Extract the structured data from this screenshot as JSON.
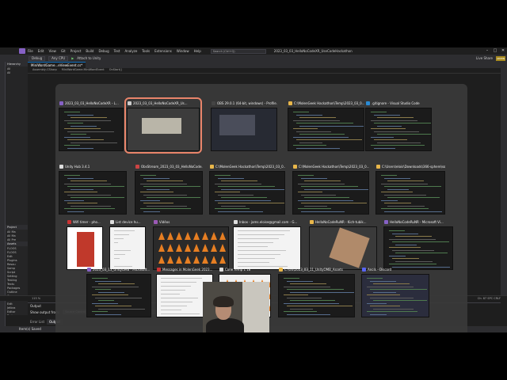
{
  "app": {
    "title": "2023_03_03_HelloNoCodeXR_UseCodeHackathon",
    "search_placeholder": "Search (Ctrl+Q)",
    "admin_label": "ADMIN",
    "live_share": "Live Share",
    "menu": [
      "File",
      "Edit",
      "View",
      "Git",
      "Project",
      "Build",
      "Debug",
      "Test",
      "Analyze",
      "Tools",
      "Extensions",
      "Window",
      "Help"
    ]
  },
  "toolbar": {
    "config": "Debug",
    "platform": "Any CPU",
    "run_label": "Attach to Unity"
  },
  "doc_tabs": [
    {
      "label": "MiniWordGame...eViewEvent.cs*",
      "active": true
    }
  ],
  "nav_bar": {
    "project": "Assembly-CSharp",
    "class": "MiniWordGame.MiniWordEvent",
    "member": "OnStart()"
  },
  "left_panel": {
    "header_top": "Hierarchy",
    "items_top": [
      "All",
      "All"
    ],
    "header_project": "Project",
    "items_project": [
      "All Ma",
      "All Ma",
      "All Pre"
    ],
    "header_assets": "Assets",
    "items_assets": [
      "FLOOS",
      "FLOOS",
      "Edit",
      "Plugins",
      "Resou",
      "Samp",
      "Script",
      "Setting",
      "Testing",
      "Textu",
      "Packages",
      "Outline",
      "Core",
      "Cust",
      "Edit",
      "Jetbra",
      "Editor",
      "Test",
      "Timel",
      "Unity"
    ]
  },
  "switcher": {
    "windows": [
      {
        "title": "2023_03_03_HelloNoCodeXR - L...",
        "icon": "vs-icon",
        "icon_color": "#8661c5",
        "thumb": "dark",
        "selected": false
      },
      {
        "title": "2023_03_03_HelloNoCodeXR_Us...",
        "icon": "unity-icon",
        "icon_color": "#cccccc",
        "thumb": "unity",
        "selected": true
      },
      {
        "title": "OBS 29.0.1 (64-bit, windows) - Profile...",
        "icon": "obs-icon",
        "icon_color": "#444444",
        "thumb": "obs",
        "selected": false
      },
      {
        "title": "C:\\MolenGeek Hackathon\\Temp\\2023_03_0...",
        "icon": "folder-icon",
        "icon_color": "#e8b64a",
        "thumb": "dark",
        "selected": false
      },
      {
        "title": ".gitignore - Visual Studio Code",
        "icon": "vscode-icon",
        "icon_color": "#2a8ad4",
        "thumb": "dark",
        "selected": false
      },
      {
        "title": "Unity Hub 3.4.1",
        "icon": "unity-hub-icon",
        "icon_color": "#dddddd",
        "thumb": "dark",
        "selected": false
      },
      {
        "title": "ObsStream_2023_03_03_HelloNoCode...",
        "icon": "unity-icon",
        "icon_color": "#cc4444",
        "thumb": "dark",
        "selected": false
      },
      {
        "title": "C:\\MolenGeek Hackathon\\Temp\\2023_03_0...",
        "icon": "folder-icon",
        "icon_color": "#e8b64a",
        "thumb": "dark",
        "selected": false
      },
      {
        "title": "C:\\MolenGeek Hackathon\\Temp\\2023_03_0...",
        "icon": "folder-icon",
        "icon_color": "#e8b64a",
        "thumb": "dark",
        "selected": false
      },
      {
        "title": "C:\\Users\\elois\\Downloads\\366-sphere\\source",
        "icon": "folder-icon",
        "icon_color": "#e8b64a",
        "thumb": "dark",
        "selected": false
      },
      {
        "title": "Wifi timer - pho...",
        "icon": "browser-icon",
        "icon_color": "#cc3333",
        "thumb": "phone",
        "selected": false
      },
      {
        "title": "List device hu...",
        "icon": "browser-icon",
        "icon_color": "#dddddd",
        "thumb": "light",
        "selected": false
      },
      {
        "title": "Vidéos",
        "icon": "video-icon",
        "icon_color": "#9b59b6",
        "thumb": "cones",
        "selected": false
      },
      {
        "title": "Inbox - jams.eloise@gmail.com - G...",
        "icon": "mail-icon",
        "icon_color": "#dddddd",
        "thumb": "light",
        "selected": false
      },
      {
        "title": "HelloNoCodeRuNR - Kich-tubik...",
        "icon": "app-icon",
        "icon_color": "#e8b64a",
        "thumb": "photo",
        "selected": false
      },
      {
        "title": "HelloNoCodeRuNR - Microsoft Vi...",
        "icon": "vs-icon",
        "icon_color": "#8661c5",
        "thumb": "dark",
        "selected": false
      },
      {
        "title": "2023_03_13_UnityOMB - Microsoft...",
        "icon": "vs-icon",
        "icon_color": "#8661c5",
        "thumb": "dark",
        "selected": false
      },
      {
        "title": "Messages in MolenGeek 2023...",
        "icon": "message-icon",
        "icon_color": "#cc3333",
        "thumb": "light",
        "selected": false
      },
      {
        "title": "Cone Temp 1 18",
        "icon": "image-icon",
        "icon_color": "#dddddd",
        "thumb": "cones-light",
        "selected": false
      },
      {
        "title": "C:\\Git\\2023_03_11_UnityOMB_Assets",
        "icon": "folder-icon",
        "icon_color": "#e8b64a",
        "thumb": "dark",
        "selected": false
      },
      {
        "title": "Aeolx - Discord",
        "icon": "discord-icon",
        "icon_color": "#5865f2",
        "thumb": "purple",
        "selected": false
      }
    ]
  },
  "status": {
    "zoom": "115 %",
    "position": "Ch: 87   SPC   CRLF"
  },
  "output": {
    "title": "Output",
    "show_from_label": "Show output from:",
    "show_from_value": "Source Control - Git"
  },
  "bottom_tabs": [
    {
      "label": "Error List",
      "active": false
    },
    {
      "label": "Output",
      "active": true
    }
  ],
  "vs_status": "Item(s) Saved"
}
